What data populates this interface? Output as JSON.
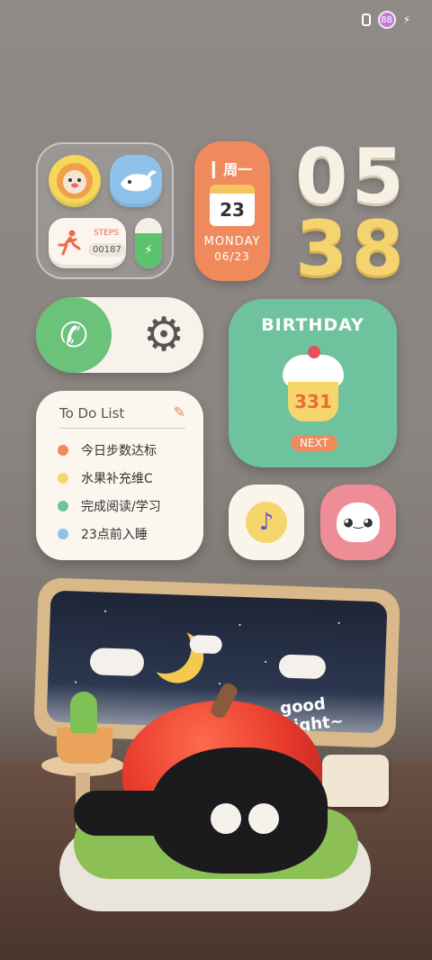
{
  "status": {
    "battery_level": "88"
  },
  "calendar": {
    "weekday_cn": "周一",
    "day": "23",
    "weekday_en": "MONDAY",
    "date": "06/23",
    "color": "#f08a5d"
  },
  "clock": {
    "hour": "05",
    "minute": "38"
  },
  "steps": {
    "label": "STEPS",
    "count": "00187"
  },
  "birthday": {
    "title": "BIRTHDAY",
    "days": "331",
    "next_label": "NEXT"
  },
  "todo": {
    "title": "To Do List",
    "items": [
      {
        "text": "今日步数达标",
        "color": "#f08a5d"
      },
      {
        "text": "水果补充维C",
        "color": "#f6d66a"
      },
      {
        "text": "完成阅读/学习",
        "color": "#6ec39e"
      },
      {
        "text": "23点前入睡",
        "color": "#8ec2ea"
      }
    ]
  },
  "wallpaper": {
    "caption": "good night~"
  },
  "icons": {
    "lion": "lion-app-icon",
    "whale": "whale-app-icon",
    "charge": "charging-icon",
    "phone": "phone-icon",
    "settings": "gear-icon",
    "tiktok": "tiktok-icon",
    "sticker": "sticker-face-icon"
  }
}
